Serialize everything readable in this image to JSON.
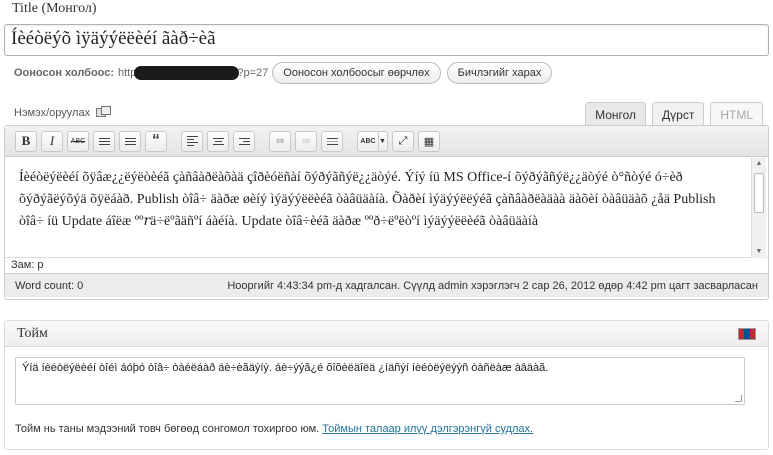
{
  "title_section": {
    "label": "Title (Монгол)",
    "value": "Íèéòëýõ ìÿäýýëëèéí ãàð÷èã"
  },
  "permalink": {
    "label": "Ооносон холбоос:",
    "url_start": "http",
    "url_end": "?p=27",
    "change_button": "Ооносон холбоосыг өөрчлөх",
    "view_button": "Бичлэгийг харах"
  },
  "media": {
    "label": "Нэмэх/оруулах",
    "icon": "media-icon"
  },
  "tabs": [
    {
      "label": "Монгол"
    },
    {
      "label": "Дүрст"
    },
    {
      "label": "HTML"
    }
  ],
  "toolbar": {
    "bold": "B",
    "italic": "I",
    "strike": "ABC",
    "quote": "“",
    "spell": "ABC"
  },
  "editor": {
    "content": "Íèéòëýëèéí õÿâæ¿¿ëýëòèéã çàñâàðëàõàä çîðèóëñàí õýðýãñýë¿¿äòýé. Ýíý íü MS Office-í õýðýãñýë¿¿äòýé ò°ñòýé ó÷èð õýðýãëýõýä õÿëáàð. Publish òîâ÷ äàðæ øèíý ìýäýýëëèéã òàâüäàíà. Õàðèí ìýäýýëëýéã çàñâàðëàäàà äàõèí òàâüäàõ ¿åä Publish òîâ÷ íü Update áîëæ ºº𝑟ä÷ëºãäñºí áàéíà. Update òîâ÷èéã äàðæ ººð÷ëºëòºí ìýäýýëëèéã òàâüäàíà",
    "path": "Зам: p",
    "word_count": "Word count: 0",
    "last_edited": "Нооргийг 4:43:34 pm-д хадгалсан. Сүүлд admin хэрэглэгч 2 сар 26, 2012 өдөр 4:42 pm цагт засварласан"
  },
  "excerpt": {
    "heading": "Тойм",
    "value": "Ýíä íèéòëýëèéí òîéì áóþó òîâ÷ òàéëáàð áè÷èãäýíý. áè÷ýýã¿é õîõèëäîëä ¿íäñýí íèéòëýëýýñ òàñëàæ àâäàã.",
    "help_text": "Тойм нь таны мэдээний товч бөгөөд сонгомол тохиргоо юм.",
    "help_link": "Тоймын талаар илүү дэлгэрэнгүй судлах."
  },
  "colors": {
    "flag_red": "#c4272f",
    "flag_blue": "#015197",
    "link": "#21759b"
  }
}
